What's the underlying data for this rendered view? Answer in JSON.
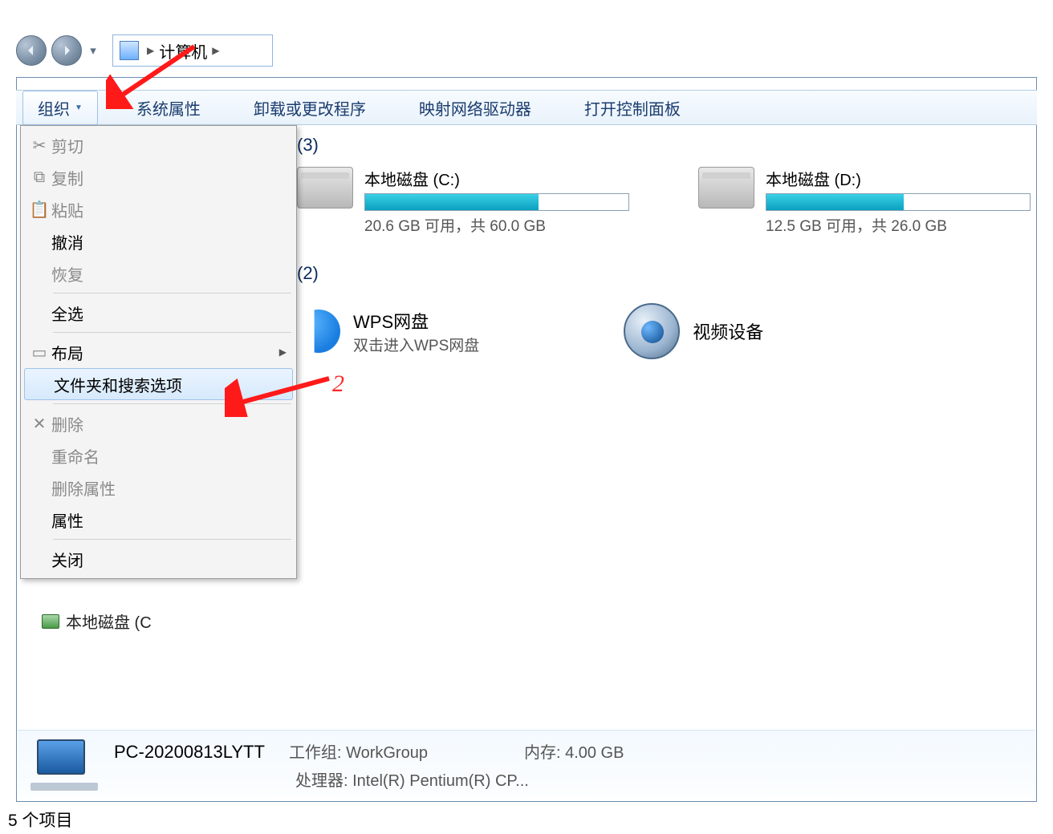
{
  "breadcrumb": {
    "location": "计算机"
  },
  "toolbar": {
    "organize": "组织",
    "items": [
      "系统属性",
      "卸载或更改程序",
      "映射网络驱动器",
      "打开控制面板"
    ]
  },
  "organize_menu": {
    "cut": "剪切",
    "copy": "复制",
    "paste": "粘贴",
    "undo": "撤消",
    "redo": "恢复",
    "select_all": "全选",
    "layout": "布局",
    "folder_options": "文件夹和搜索选项",
    "delete": "删除",
    "rename": "重命名",
    "remove_props": "删除属性",
    "properties": "属性",
    "close": "关闭"
  },
  "sections": {
    "hard_drives_count": "(3)",
    "other_count": "(2)"
  },
  "drives": [
    {
      "title": "本地磁盘 (C:)",
      "usage_text": "20.6 GB 可用，共 60.0 GB",
      "fill_pct": 66
    },
    {
      "title": "本地磁盘 (D:)",
      "usage_text": "12.5 GB 可用，共 26.0 GB",
      "fill_pct": 52
    }
  ],
  "other_items": {
    "wps_title": "WPS网盘",
    "wps_sub": "双击进入WPS网盘",
    "video": "视频设备"
  },
  "sidebar": {
    "local_disk": "本地磁盘 (C"
  },
  "details": {
    "pc_name": "PC-20200813LYTT",
    "workgroup_label": "工作组:",
    "workgroup_value": "WorkGroup",
    "memory_label": "内存:",
    "memory_value": "4.00 GB",
    "cpu_label": "处理器:",
    "cpu_value": "Intel(R) Pentium(R) CP..."
  },
  "status": {
    "text": "5 个项目"
  },
  "annotations": {
    "num2": "2"
  }
}
